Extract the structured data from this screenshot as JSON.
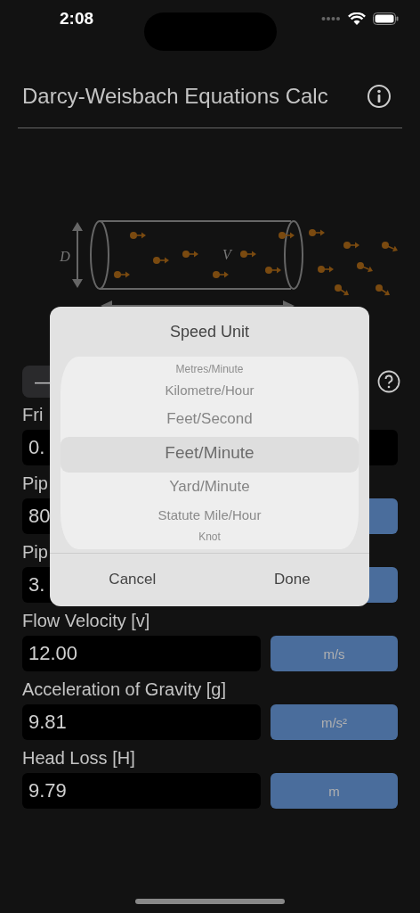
{
  "status_bar": {
    "time": "2:08"
  },
  "header": {
    "title": "Darcy-Weisbach Equations Calc"
  },
  "diagram": {
    "labels": [
      {
        "kind": "diameter",
        "text": "D"
      },
      {
        "kind": "velocity",
        "text": "V"
      }
    ]
  },
  "mode_control": {
    "label": "—"
  },
  "rows": [
    {
      "label": "Fri",
      "value": "0.",
      "kind": "plain"
    },
    {
      "label": "Pip",
      "value": "80",
      "kind": "with-unit"
    },
    {
      "label": "Pip",
      "value": "3.",
      "kind": "with-unit"
    },
    {
      "label": "Flow Velocity [v]",
      "value": "12.00",
      "kind": "with-unit",
      "unit": "m/s"
    },
    {
      "label": "Acceleration of Gravity [g]",
      "value": "9.81",
      "kind": "with-unit",
      "unit": "m/s²"
    },
    {
      "label": "Head Loss [H]",
      "value": "9.79",
      "kind": "with-unit",
      "unit": "m"
    }
  ],
  "dialog": {
    "title": "Speed Unit",
    "options": [
      {
        "label": "Metres/Minute",
        "selected": false
      },
      {
        "label": "Kilometre/Hour",
        "selected": false
      },
      {
        "label": "Feet/Second",
        "selected": false
      },
      {
        "label": "Feet/Minute",
        "selected": true
      },
      {
        "label": "Yard/Minute",
        "selected": false
      },
      {
        "label": "Statute Mile/Hour",
        "selected": false
      },
      {
        "label": "Knot",
        "selected": false
      }
    ],
    "buttons": [
      "Cancel",
      "Done"
    ]
  }
}
